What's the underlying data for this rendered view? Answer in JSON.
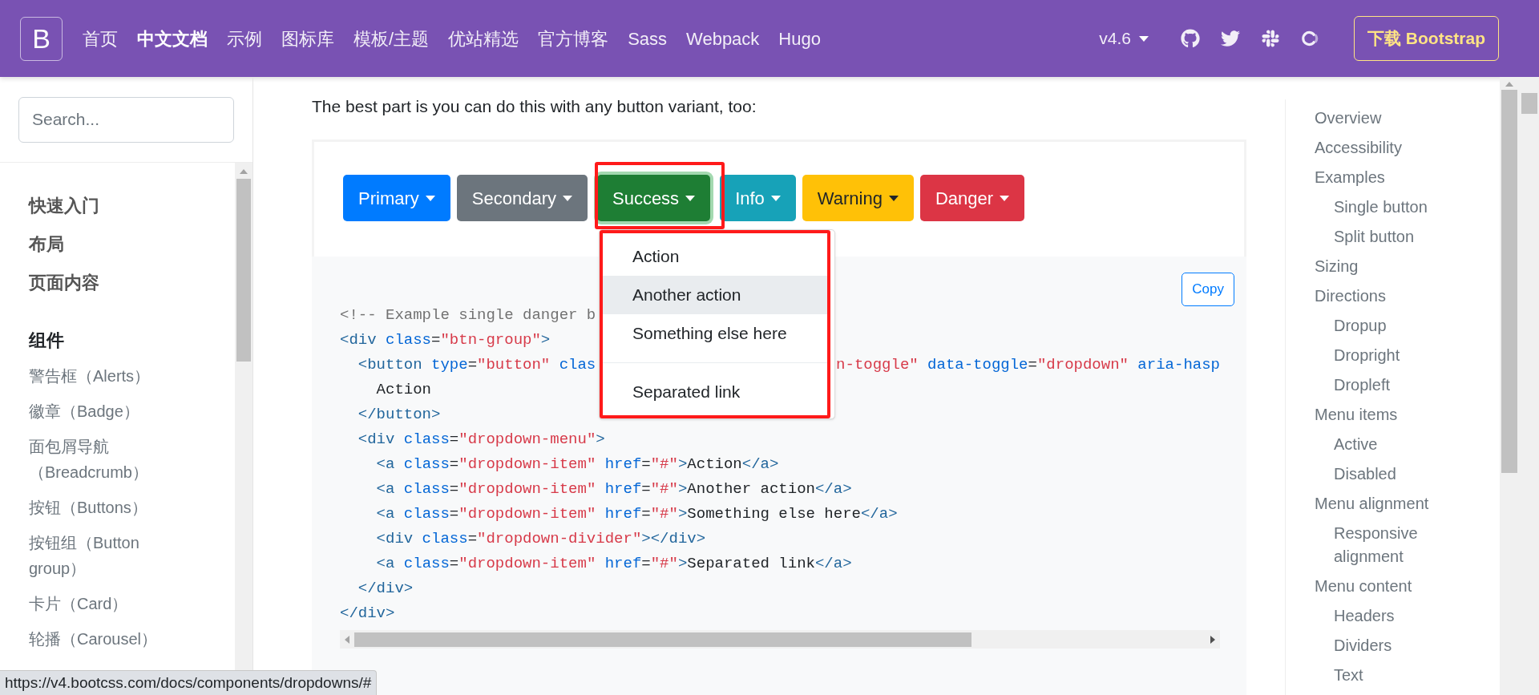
{
  "navbar": {
    "brand": "B",
    "links": [
      {
        "label": "首页",
        "selected": false
      },
      {
        "label": "中文文档",
        "selected": true
      },
      {
        "label": "示例",
        "selected": false
      },
      {
        "label": "图标库",
        "selected": false
      },
      {
        "label": "模板/主题",
        "selected": false
      },
      {
        "label": "优站精选",
        "selected": false
      },
      {
        "label": "官方博客",
        "selected": false
      },
      {
        "label": "Sass",
        "selected": false
      },
      {
        "label": "Webpack",
        "selected": false
      },
      {
        "label": "Hugo",
        "selected": false
      }
    ],
    "version": "v4.6",
    "download_button": "下载 Bootstrap"
  },
  "sidebar": {
    "search": {
      "placeholder": "Search..."
    },
    "items": [
      {
        "kind": "section",
        "label": "快速入门"
      },
      {
        "kind": "section",
        "label": "布局"
      },
      {
        "kind": "section",
        "label": "页面内容"
      },
      {
        "kind": "heading",
        "label": "组件"
      },
      {
        "kind": "item",
        "label": "警告框（Alerts）"
      },
      {
        "kind": "item",
        "label": "徽章（Badge）"
      },
      {
        "kind": "item",
        "label": "面包屑导航（Breadcrumb）"
      },
      {
        "kind": "item",
        "label": "按钮（Buttons）"
      },
      {
        "kind": "item",
        "label": "按钮组（Button group）"
      },
      {
        "kind": "item",
        "label": "卡片（Card）"
      },
      {
        "kind": "item",
        "label": "轮播（Carousel）"
      }
    ]
  },
  "main": {
    "intro": "The best part is you can do this with any button variant, too:",
    "buttons": [
      {
        "label": "Primary",
        "selected": false
      },
      {
        "label": "Secondary",
        "selected": false
      },
      {
        "label": "Success",
        "selected": true
      },
      {
        "label": "Info",
        "selected": false
      },
      {
        "label": "Warning",
        "selected": false
      },
      {
        "label": "Danger",
        "selected": false
      }
    ],
    "dropdown": {
      "items": [
        {
          "kind": "item",
          "label": "Action",
          "selected": false
        },
        {
          "kind": "item",
          "label": "Another action",
          "selected": true
        },
        {
          "kind": "item",
          "label": "Something else here",
          "selected": false
        },
        {
          "kind": "divider"
        },
        {
          "kind": "item",
          "label": "Separated link",
          "selected": false
        }
      ]
    },
    "copy_button": "Copy",
    "code": [
      [
        {
          "kind": "comment",
          "text": "<!-- Example single danger b"
        }
      ],
      [
        {
          "kind": "tag",
          "text": "<div"
        },
        {
          "kind": "attr",
          "text": " class"
        },
        {
          "kind": "plain",
          "text": "="
        },
        {
          "kind": "str",
          "text": "\"btn-group\""
        },
        {
          "kind": "tag",
          "text": ">"
        }
      ],
      [
        {
          "kind": "tag",
          "text": "  <button"
        },
        {
          "kind": "attr",
          "text": " type"
        },
        {
          "kind": "plain",
          "text": "="
        },
        {
          "kind": "str",
          "text": "\"button\""
        },
        {
          "kind": "attr",
          "text": " clas"
        },
        {
          "kind": "gap"
        },
        {
          "kind": "str",
          "text": "n-toggle\""
        },
        {
          "kind": "attr",
          "text": " data-toggle"
        },
        {
          "kind": "plain",
          "text": "="
        },
        {
          "kind": "str",
          "text": "\"dropdown\""
        },
        {
          "kind": "attr",
          "text": " aria-hasp"
        }
      ],
      [
        {
          "kind": "plain",
          "text": "    Action"
        }
      ],
      [
        {
          "kind": "tag",
          "text": "  </button>"
        }
      ],
      [
        {
          "kind": "tag",
          "text": "  <div"
        },
        {
          "kind": "attr",
          "text": " class"
        },
        {
          "kind": "plain",
          "text": "="
        },
        {
          "kind": "str",
          "text": "\"dropdown-menu\""
        },
        {
          "kind": "tag",
          "text": ">"
        }
      ],
      [
        {
          "kind": "tag",
          "text": "    <a"
        },
        {
          "kind": "attr",
          "text": " class"
        },
        {
          "kind": "plain",
          "text": "="
        },
        {
          "kind": "str",
          "text": "\"dropdown-item\""
        },
        {
          "kind": "attr",
          "text": " href"
        },
        {
          "kind": "plain",
          "text": "="
        },
        {
          "kind": "str",
          "text": "\"#\""
        },
        {
          "kind": "tag",
          "text": ">"
        },
        {
          "kind": "plain",
          "text": "Action"
        },
        {
          "kind": "tag",
          "text": "</a>"
        }
      ],
      [
        {
          "kind": "tag",
          "text": "    <a"
        },
        {
          "kind": "attr",
          "text": " class"
        },
        {
          "kind": "plain",
          "text": "="
        },
        {
          "kind": "str",
          "text": "\"dropdown-item\""
        },
        {
          "kind": "attr",
          "text": " href"
        },
        {
          "kind": "plain",
          "text": "="
        },
        {
          "kind": "str",
          "text": "\"#\""
        },
        {
          "kind": "tag",
          "text": ">"
        },
        {
          "kind": "plain",
          "text": "Another action"
        },
        {
          "kind": "tag",
          "text": "</a>"
        }
      ],
      [
        {
          "kind": "tag",
          "text": "    <a"
        },
        {
          "kind": "attr",
          "text": " class"
        },
        {
          "kind": "plain",
          "text": "="
        },
        {
          "kind": "str",
          "text": "\"dropdown-item\""
        },
        {
          "kind": "attr",
          "text": " href"
        },
        {
          "kind": "plain",
          "text": "="
        },
        {
          "kind": "str",
          "text": "\"#\""
        },
        {
          "kind": "tag",
          "text": ">"
        },
        {
          "kind": "plain",
          "text": "Something else here"
        },
        {
          "kind": "tag",
          "text": "</a>"
        }
      ],
      [
        {
          "kind": "tag",
          "text": "    <div"
        },
        {
          "kind": "attr",
          "text": " class"
        },
        {
          "kind": "plain",
          "text": "="
        },
        {
          "kind": "str",
          "text": "\"dropdown-divider\""
        },
        {
          "kind": "tag",
          "text": "></div>"
        }
      ],
      [
        {
          "kind": "tag",
          "text": "    <a"
        },
        {
          "kind": "attr",
          "text": " class"
        },
        {
          "kind": "plain",
          "text": "="
        },
        {
          "kind": "str",
          "text": "\"dropdown-item\""
        },
        {
          "kind": "attr",
          "text": " href"
        },
        {
          "kind": "plain",
          "text": "="
        },
        {
          "kind": "str",
          "text": "\"#\""
        },
        {
          "kind": "tag",
          "text": ">"
        },
        {
          "kind": "plain",
          "text": "Separated link"
        },
        {
          "kind": "tag",
          "text": "</a>"
        }
      ],
      [
        {
          "kind": "tag",
          "text": "  </div>"
        }
      ],
      [
        {
          "kind": "tag",
          "text": "</div>"
        }
      ]
    ]
  },
  "toc": [
    {
      "label": "Overview"
    },
    {
      "label": "Accessibility"
    },
    {
      "label": "Examples",
      "children": [
        {
          "label": "Single button"
        },
        {
          "label": "Split button"
        }
      ]
    },
    {
      "label": "Sizing"
    },
    {
      "label": "Directions",
      "children": [
        {
          "label": "Dropup"
        },
        {
          "label": "Dropright"
        },
        {
          "label": "Dropleft"
        }
      ]
    },
    {
      "label": "Menu items",
      "children": [
        {
          "label": "Active"
        },
        {
          "label": "Disabled"
        }
      ]
    },
    {
      "label": "Menu alignment",
      "children": [
        {
          "label": "Responsive alignment"
        }
      ]
    },
    {
      "label": "Menu content",
      "children": [
        {
          "label": "Headers"
        },
        {
          "label": "Dividers"
        },
        {
          "label": "Text"
        }
      ]
    }
  ],
  "status_url": "https://v4.bootcss.com/docs/components/dropdowns/#"
}
